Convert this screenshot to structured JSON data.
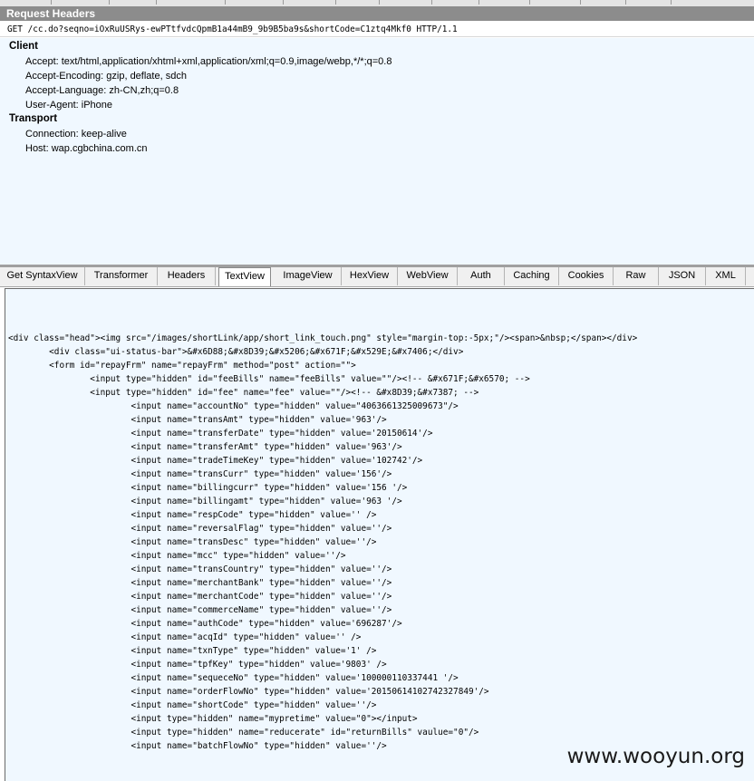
{
  "request_headers_title": "Request Headers",
  "request_line": "GET /cc.do?seqno=iOxRuUSRys-ewPTtfvdcQpmB1a44mB9_9b9B5ba9s&shortCode=C1ztq4Mkf0 HTTP/1.1",
  "groups": [
    {
      "title": "Client",
      "lines": [
        "Accept: text/html,application/xhtml+xml,application/xml;q=0.9,image/webp,*/*;q=0.8",
        "Accept-Encoding: gzip, deflate, sdch",
        "Accept-Language: zh-CN,zh;q=0.8",
        "User-Agent: iPhone"
      ]
    },
    {
      "title": "Transport",
      "lines": [
        "Connection: keep-alive",
        "Host: wap.cgbchina.com.cn"
      ]
    }
  ],
  "tabs": [
    {
      "label": "Get SyntaxView",
      "active": false
    },
    {
      "label": "Transformer",
      "active": false
    },
    {
      "label": "Headers",
      "active": false
    },
    {
      "label": "TextView",
      "active": true
    },
    {
      "label": "ImageView",
      "active": false
    },
    {
      "label": "HexView",
      "active": false
    },
    {
      "label": "WebView",
      "active": false
    },
    {
      "label": "Auth",
      "active": false
    },
    {
      "label": "Caching",
      "active": false
    },
    {
      "label": "Cookies",
      "active": false
    },
    {
      "label": "Raw",
      "active": false
    },
    {
      "label": "JSON",
      "active": false
    },
    {
      "label": "XML",
      "active": false
    }
  ],
  "body_lines": [
    "<div class=\"head\"><img src=\"/images/shortLink/app/short_link_touch.png\" style=\"margin-top:-5px;\"/><span>&nbsp;</span></div>",
    "        <div class=\"ui-status-bar\">&#x6D88;&#x8D39;&#x5206;&#x671F;&#x529E;&#x7406;</div>",
    "        <form id=\"repayFrm\" name=\"repayFrm\" method=\"post\" action=\"\">",
    "                <input type=\"hidden\" id=\"feeBills\" name=\"feeBills\" value=\"\"/><!-- &#x671F;&#x6570; -->",
    "                <input type=\"hidden\" id=\"fee\" name=\"fee\" value=\"\"/><!-- &#x8D39;&#x7387; -->",
    "                        <input name=\"accountNo\" type=\"hidden\" value=\"4063661325009673\"/>",
    "                        <input name=\"transAmt\" type=\"hidden\" value='963'/>",
    "                        <input name=\"transferDate\" type=\"hidden\" value='20150614'/>",
    "                        <input name=\"transferAmt\" type=\"hidden\" value='963'/>",
    "                        <input name=\"tradeTimeKey\" type=\"hidden\" value='102742'/>",
    "                        <input name=\"transCurr\" type=\"hidden\" value='156'/>",
    "                        <input name=\"billingcurr\" type=\"hidden\" value='156 '/>",
    "                        <input name=\"billingamt\" type=\"hidden\" value='963 '/>",
    "                        <input name=\"respCode\" type=\"hidden\" value='' />",
    "                        <input name=\"reversalFlag\" type=\"hidden\" value=''/>",
    "                        <input name=\"transDesc\" type=\"hidden\" value=''/>",
    "                        <input name=\"mcc\" type=\"hidden\" value=''/>",
    "                        <input name=\"transCountry\" type=\"hidden\" value=''/>",
    "                        <input name=\"merchantBank\" type=\"hidden\" value=''/>",
    "                        <input name=\"merchantCode\" type=\"hidden\" value=''/>",
    "                        <input name=\"commerceName\" type=\"hidden\" value=''/>",
    "                        <input name=\"authCode\" type=\"hidden\" value='696287'/>",
    "                        <input name=\"acqId\" type=\"hidden\" value='' />",
    "                        <input name=\"txnType\" type=\"hidden\" value='1' />",
    "                        <input name=\"tpfKey\" type=\"hidden\" value='9803' />",
    "                        <input name=\"sequeceNo\" type=\"hidden\" value='100000110337441 '/>",
    "                        <input name=\"orderFlowNo\" type=\"hidden\" value='20150614102742327849'/>",
    "                        <input name=\"shortCode\" type=\"hidden\" value=''/>",
    "                        <input type=\"hidden\" name=\"mypretime\" value=\"0\"></input>",
    "                        <input type=\"hidden\" name=\"reducerate\" id=\"returnBills\" vaulue=\"0\"/>",
    "                        <input name=\"batchFlowNo\" type=\"hidden\" value=''/>"
  ],
  "watermark": "www.wooyun.org"
}
